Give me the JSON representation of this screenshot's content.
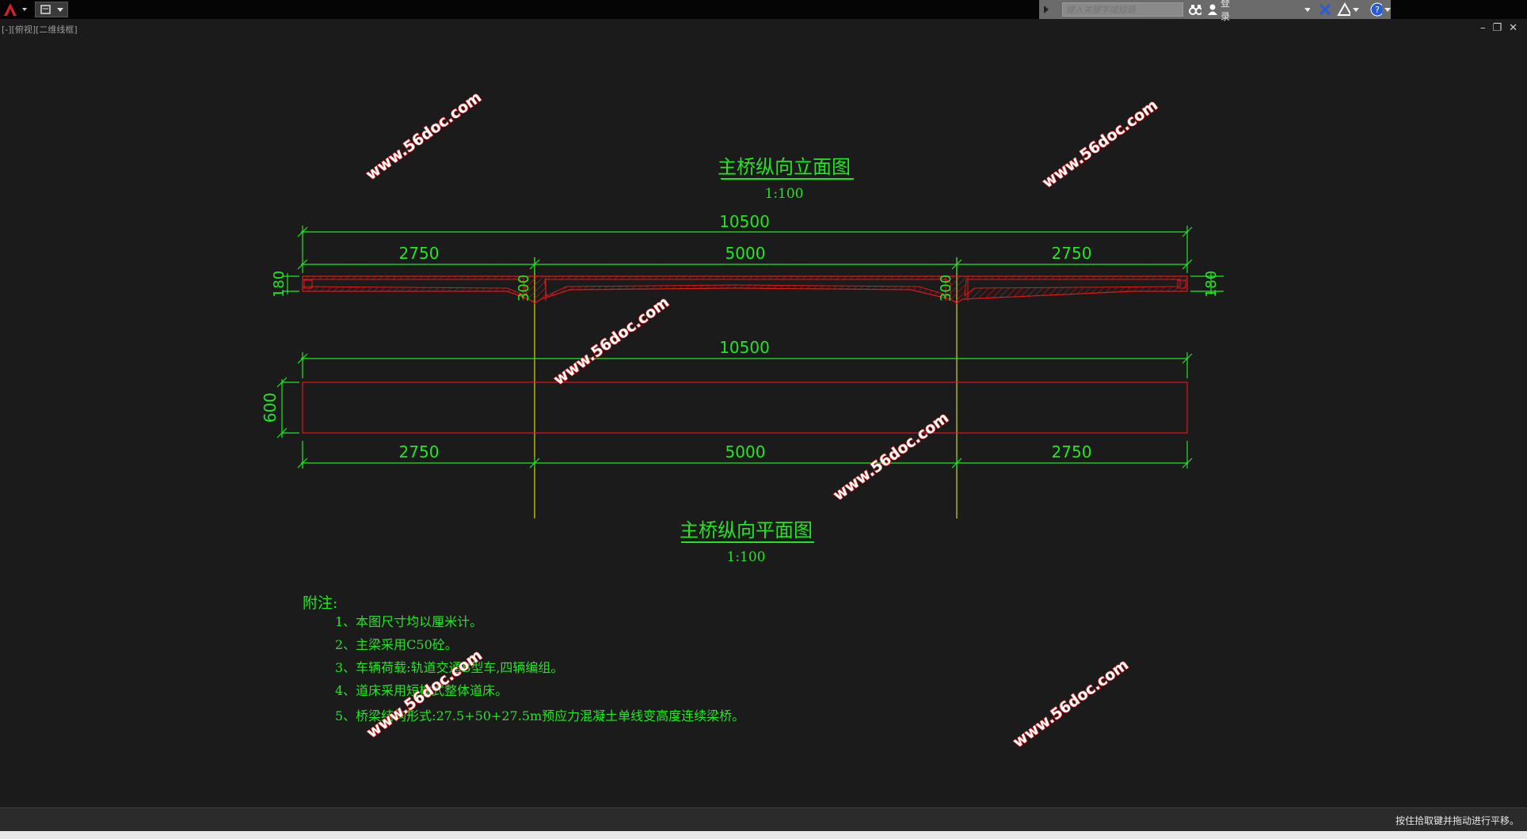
{
  "toolbar": {
    "search_placeholder": "键入关键字或短语",
    "login_label": "登录"
  },
  "viewport": {
    "label": "[-][俯视][二维线框]"
  },
  "drawing": {
    "elevation_title": "主桥纵向立面图",
    "elevation_scale": "1:100",
    "plan_title": "主桥纵向平面图",
    "plan_scale": "1:100",
    "dims": {
      "total_top": "10500",
      "span_left": "2750",
      "span_mid": "5000",
      "span_right": "2750",
      "end_height_left": "180",
      "end_height_right": "180",
      "pier_height_left": "300",
      "pier_height_right": "300",
      "total_plan": "10500",
      "plan_width": "600",
      "plan_span_left": "2750",
      "plan_span_mid": "5000",
      "plan_span_right": "2750"
    },
    "notes_title": "附注:",
    "notes": [
      "1、本图尺寸均以厘米计。",
      "2、主梁采用C50砼。",
      "3、车辆荷载:轨道交通B型车,四辆编组。",
      "4、道床采用短枕式整体道床。",
      "5、桥梁结构形式:27.5+50+27.5m预应力混凝土单线变高度连续梁桥。"
    ],
    "watermark": "www.56doc.com"
  },
  "status": {
    "message": "按住拾取键并拖动进行平移。"
  },
  "colors": {
    "dim_green": "#24e524",
    "outline_red": "#e01818",
    "axis_yellow": "#d8d814"
  }
}
